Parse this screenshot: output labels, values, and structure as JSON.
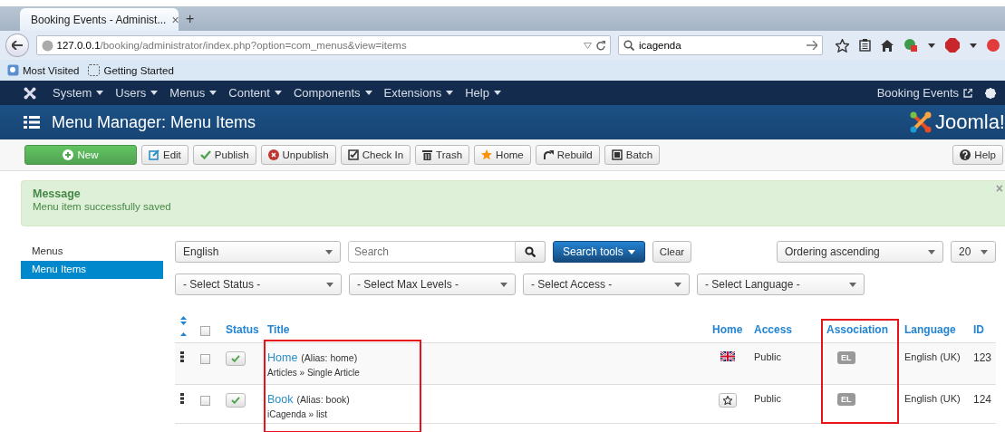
{
  "browser": {
    "tab_title": "Booking Events - Administ...",
    "tab_close": "×",
    "new_tab": "+",
    "url": "**127.0.0.1**/booking/administrator/index.php?option=com_menus&view=items",
    "search_value": "icagenda",
    "bookmarks": [
      {
        "label": "Most Visited",
        "kind": "smart"
      },
      {
        "label": "Getting Started",
        "kind": "page"
      }
    ]
  },
  "admin_menu": {
    "items": [
      {
        "label": "System"
      },
      {
        "label": "Users"
      },
      {
        "label": "Menus"
      },
      {
        "label": "Content"
      },
      {
        "label": "Components"
      },
      {
        "label": "Extensions"
      },
      {
        "label": "Help"
      }
    ],
    "site_link": "Booking Events"
  },
  "page_title": "Menu Manager: Menu Items",
  "logo_text": "Joomla!",
  "toolbar": {
    "buttons": [
      {
        "label": "New",
        "kind": "new"
      },
      {
        "label": "Edit",
        "kind": "edit"
      },
      {
        "label": "Publish",
        "kind": "publish"
      },
      {
        "label": "Unpublish",
        "kind": "unpublish"
      },
      {
        "label": "Check In",
        "kind": "checkin"
      },
      {
        "label": "Trash",
        "kind": "trash"
      },
      {
        "label": "Home",
        "kind": "home"
      },
      {
        "label": "Rebuild",
        "kind": "rebuild"
      },
      {
        "label": "Batch",
        "kind": "batch"
      }
    ],
    "help": {
      "label": "Help",
      "kind": "help"
    }
  },
  "message": {
    "heading": "Message",
    "text": "Menu item successfully saved",
    "close": "×"
  },
  "sidebar": {
    "items": [
      {
        "label": "Menus",
        "selected": false
      },
      {
        "label": "Menu Items",
        "selected": true
      }
    ]
  },
  "filters": {
    "menu_select": "English",
    "search": {
      "placeholder": "Search"
    },
    "search_tools": "Search tools",
    "clear": "Clear",
    "ordering_select": "Ordering ascending",
    "limit_select": "20",
    "selects": [
      "- Select Status -",
      "- Select Max Levels -",
      "- Select Access -",
      "- Select Language -"
    ]
  },
  "table": {
    "select_all_checked": false,
    "columns": [
      {
        "label": "Status",
        "highlighted": false,
        "header_highlighted": false
      },
      {
        "label": "Title",
        "highlighted": true,
        "header_highlighted": false
      },
      {
        "label": "Home",
        "highlighted": false,
        "header_highlighted": false
      },
      {
        "label": "Access",
        "highlighted": false,
        "header_highlighted": false
      },
      {
        "label": "Association",
        "highlighted": true,
        "header_highlighted": true
      },
      {
        "label": "Language",
        "highlighted": false,
        "header_highlighted": false
      },
      {
        "label": "ID",
        "highlighted": false,
        "header_highlighted": false
      }
    ],
    "rows": [
      {
        "checked": false,
        "published": true,
        "title": "Home",
        "alias": "(Alias: home)",
        "type": "Articles » Single Article",
        "home": {
          "kind": "flag"
        },
        "access": "Public",
        "association": "EL",
        "language": "English (UK)",
        "id": "123"
      },
      {
        "checked": false,
        "published": true,
        "title": "Book",
        "alias": "(Alias: book)",
        "type": "iCagenda » list",
        "home": {
          "kind": "star"
        },
        "access": "Public",
        "association": "EL",
        "language": "English (UK)",
        "id": "124"
      }
    ]
  }
}
